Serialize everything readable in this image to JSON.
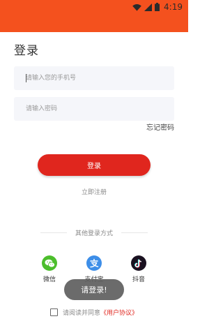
{
  "status_bar": {
    "time": "4:19",
    "background_color": "#f4511e",
    "icons": [
      "wifi-icon",
      "signal-icon",
      "battery-icon"
    ]
  },
  "page_title": "登录",
  "phone_field": {
    "placeholder": "请输入您的手机号",
    "value": ""
  },
  "password_field": {
    "placeholder": "请输入密码",
    "value": ""
  },
  "forgot_password": "忘记密码",
  "login_button": {
    "label": "登录",
    "color": "#e0261e"
  },
  "register_link": "立即注册",
  "other_login": {
    "title": "其他登录方式",
    "options": [
      {
        "label": "微信",
        "icon": "wechat-icon",
        "color": "#4cbe2c"
      },
      {
        "label": "支付宝",
        "icon": "alipay-icon",
        "color": "#3d8ee8"
      },
      {
        "label": "抖音",
        "icon": "douyin-icon",
        "color": "#1a1120"
      }
    ]
  },
  "toast": "请登录!",
  "agreement": {
    "checked": false,
    "text": "请阅读并同意",
    "link": "《用户协议》",
    "link_color": "#e0261e"
  }
}
